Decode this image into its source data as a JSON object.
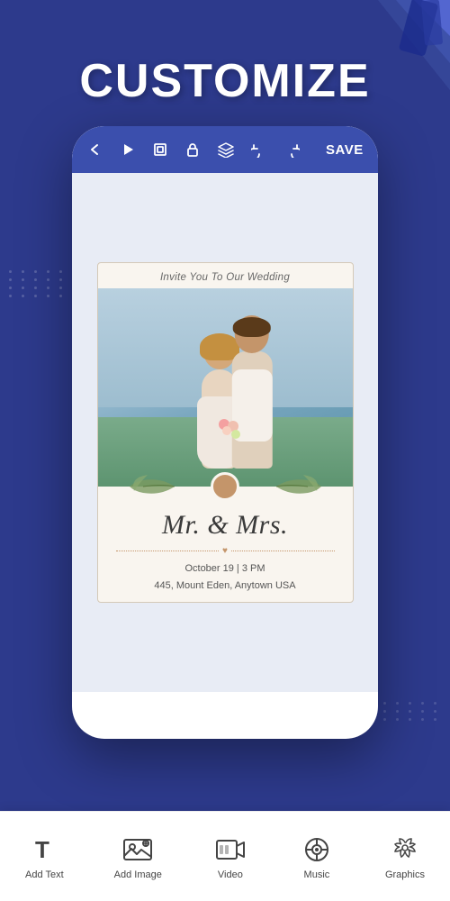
{
  "page": {
    "title": "CUSTOMIZE",
    "background_color": "#2d3a8c"
  },
  "toolbar": {
    "back_label": "‹",
    "play_label": "▶",
    "layers_label": "⊞",
    "lock_label": "🔓",
    "stack_label": "❖",
    "undo_label": "↺",
    "redo_label": "↻",
    "save_label": "SAVE"
  },
  "wedding_card": {
    "invite_text": "Invite You To Our Wedding",
    "names": "Mr. & Mrs.",
    "date": "October 19 | 3 PM",
    "address": "445, Mount Eden, Anytown USA"
  },
  "bottom_nav": {
    "items": [
      {
        "id": "add-text",
        "label": "Add Text",
        "icon": "T"
      },
      {
        "id": "add-image",
        "label": "Add Image",
        "icon": "🖼"
      },
      {
        "id": "video",
        "label": "Video",
        "icon": "📹"
      },
      {
        "id": "music",
        "label": "Music",
        "icon": "🎵"
      },
      {
        "id": "graphics",
        "label": "Graphics",
        "icon": "🌿"
      }
    ]
  }
}
